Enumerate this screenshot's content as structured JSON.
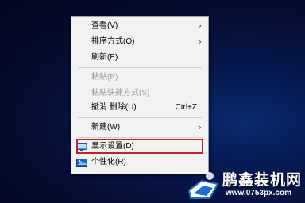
{
  "context_menu": {
    "view": {
      "label": "查看(V)",
      "has_submenu": true
    },
    "sort": {
      "label": "排序方式(O)",
      "has_submenu": true
    },
    "refresh": {
      "label": "刷新(E)"
    },
    "paste": {
      "label": "粘贴(P)",
      "disabled": true
    },
    "paste_shortcut": {
      "label": "粘贴快捷方式(S)",
      "disabled": true
    },
    "undo_delete": {
      "label": "撤消 删除(U)",
      "shortcut": "Ctrl+Z"
    },
    "new": {
      "label": "新建(W)",
      "has_submenu": true
    },
    "display_settings": {
      "label": "显示设置(D)",
      "icon": "display-icon",
      "highlighted": true
    },
    "personalize": {
      "label": "个性化(R)",
      "icon": "personalize-icon"
    }
  },
  "submenu_arrow": "›",
  "watermark": {
    "brand": "鹏鑫装机网",
    "url": "www.0753px.com"
  },
  "colors": {
    "highlight_border": "#c8201e",
    "menu_background": "#f2f2f2",
    "disabled_text": "#9a9a9a"
  }
}
